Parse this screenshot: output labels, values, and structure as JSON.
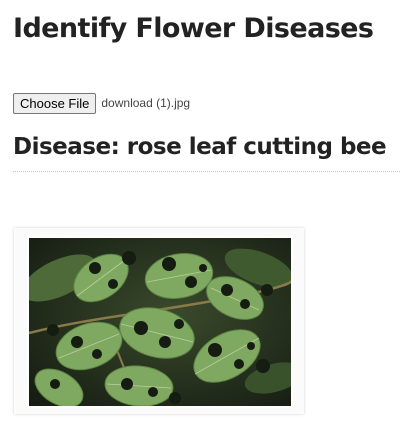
{
  "page": {
    "title": "Identify Flower Diseases"
  },
  "upload": {
    "button_label": "Choose File",
    "file_name": "download (1).jpg"
  },
  "result": {
    "heading": "Disease: rose leaf cutting bee"
  },
  "image": {
    "subject": "leaves with circular cut-outs",
    "colors": {
      "leaf": "#7fa860",
      "leaf_dark": "#5c8544",
      "background": "#1f2a1a",
      "vein": "#c9d9b0"
    }
  }
}
